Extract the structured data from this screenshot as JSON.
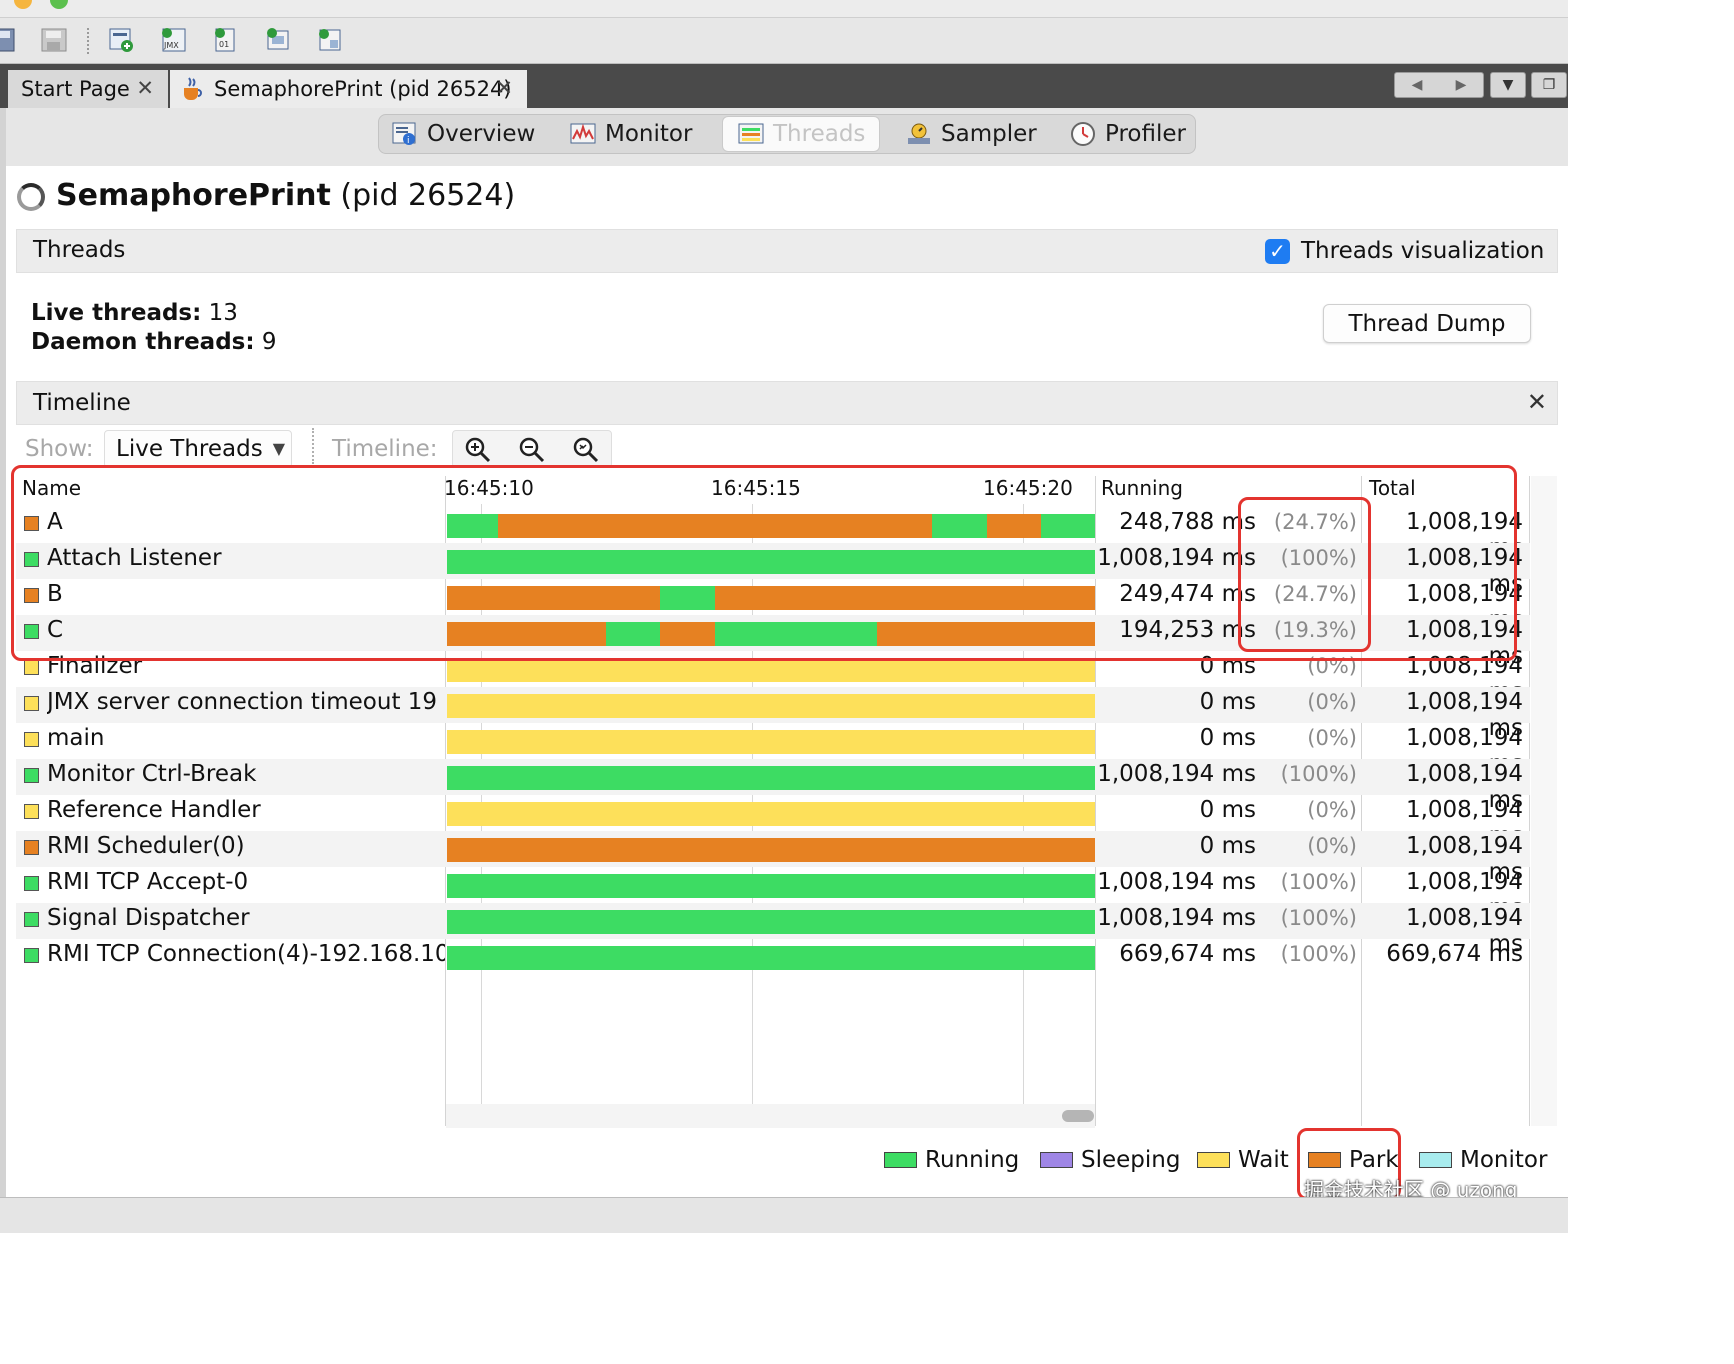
{
  "window": {
    "tabs": [
      {
        "label": "Start Page",
        "close": "✕"
      },
      {
        "label": "SemaphorePrint (pid 26524)",
        "close": "✕"
      }
    ]
  },
  "views": [
    "Overview",
    "Monitor",
    "Threads",
    "Sampler",
    "Profiler"
  ],
  "process": {
    "name": "SemaphorePrint",
    "pid": "(pid 26524)"
  },
  "threads_panel": {
    "title": "Threads",
    "visualization_label": "Threads visualization",
    "visualization_checked": true,
    "live_label": "Live threads:",
    "live_value": "13",
    "daemon_label": "Daemon threads:",
    "daemon_value": "9",
    "dump_button": "Thread Dump"
  },
  "timeline_panel": {
    "title": "Timeline",
    "close": "✕",
    "show_label": "Show:",
    "show_value": "Live Threads",
    "timeline_label": "Timeline:"
  },
  "table": {
    "headers": {
      "name": "Name",
      "running": "Running",
      "total": "Total"
    },
    "times": [
      "16:45:10",
      "16:45:15",
      "16:45:20"
    ],
    "rows": [
      {
        "name": "A",
        "state": "park",
        "running": "248,788 ms",
        "pct": "(24.7%)",
        "total": "1,008,194 ms",
        "segments": [
          [
            "running",
            0.078
          ],
          [
            "park",
            0.67
          ],
          [
            "running",
            0.085
          ],
          [
            "park",
            0.083
          ],
          [
            "running",
            0.084
          ]
        ]
      },
      {
        "name": "Attach Listener",
        "state": "running",
        "running": "1,008,194 ms",
        "pct": "(100%)",
        "total": "1,008,194 ms",
        "segments": [
          [
            "running",
            1.0
          ]
        ]
      },
      {
        "name": "B",
        "state": "park",
        "running": "249,474 ms",
        "pct": "(24.7%)",
        "total": "1,008,194 ms",
        "segments": [
          [
            "park",
            0.329
          ],
          [
            "running",
            0.084
          ],
          [
            "park",
            0.587
          ]
        ]
      },
      {
        "name": "C",
        "state": "running",
        "running": "194,253 ms",
        "pct": "(19.3%)",
        "total": "1,008,194 ms",
        "segments": [
          [
            "park",
            0.245
          ],
          [
            "running",
            0.084
          ],
          [
            "park",
            0.084
          ],
          [
            "running",
            0.251
          ],
          [
            "park",
            0.336
          ]
        ]
      },
      {
        "name": "Finalizer",
        "state": "wait",
        "running": "0 ms",
        "pct": "(0%)",
        "total": "1,008,194 ms",
        "segments": [
          [
            "wait",
            1.0
          ]
        ]
      },
      {
        "name": "JMX server connection timeout 19",
        "state": "wait",
        "running": "0 ms",
        "pct": "(0%)",
        "total": "1,008,194 ms",
        "segments": [
          [
            "wait",
            1.0
          ]
        ]
      },
      {
        "name": "main",
        "state": "wait",
        "running": "0 ms",
        "pct": "(0%)",
        "total": "1,008,194 ms",
        "segments": [
          [
            "wait",
            1.0
          ]
        ]
      },
      {
        "name": "Monitor Ctrl-Break",
        "state": "running",
        "running": "1,008,194 ms",
        "pct": "(100%)",
        "total": "1,008,194 ms",
        "segments": [
          [
            "running",
            1.0
          ]
        ]
      },
      {
        "name": "Reference Handler",
        "state": "wait",
        "running": "0 ms",
        "pct": "(0%)",
        "total": "1,008,194 ms",
        "segments": [
          [
            "wait",
            1.0
          ]
        ]
      },
      {
        "name": "RMI Scheduler(0)",
        "state": "park",
        "running": "0 ms",
        "pct": "(0%)",
        "total": "1,008,194 ms",
        "segments": [
          [
            "park",
            1.0
          ]
        ]
      },
      {
        "name": "RMI TCP Accept-0",
        "state": "running",
        "running": "1,008,194 ms",
        "pct": "(100%)",
        "total": "1,008,194 ms",
        "segments": [
          [
            "running",
            1.0
          ]
        ]
      },
      {
        "name": "Signal Dispatcher",
        "state": "running",
        "running": "1,008,194 ms",
        "pct": "(100%)",
        "total": "1,008,194 ms",
        "segments": [
          [
            "running",
            1.0
          ]
        ]
      },
      {
        "name": "RMI TCP Connection(4)-192.168.10",
        "state": "running",
        "running": "669,674 ms",
        "pct": "(100%)",
        "total": "669,674 ms",
        "segments": [
          [
            "running",
            1.0
          ]
        ]
      }
    ]
  },
  "legend": [
    {
      "label": "Running",
      "state": "running"
    },
    {
      "label": "Sleeping",
      "state": "sleeping"
    },
    {
      "label": "Wait",
      "state": "wait"
    },
    {
      "label": "Park",
      "state": "park"
    },
    {
      "label": "Monitor",
      "state": "monitor"
    }
  ],
  "colors": {
    "running": "#3ddc63",
    "sleeping": "#9f86e6",
    "wait": "#fde05a",
    "park": "#e68122",
    "monitor": "#a8ecee",
    "highlight": "#e3342f"
  },
  "watermark": "掘金技术社区 @ uzong"
}
